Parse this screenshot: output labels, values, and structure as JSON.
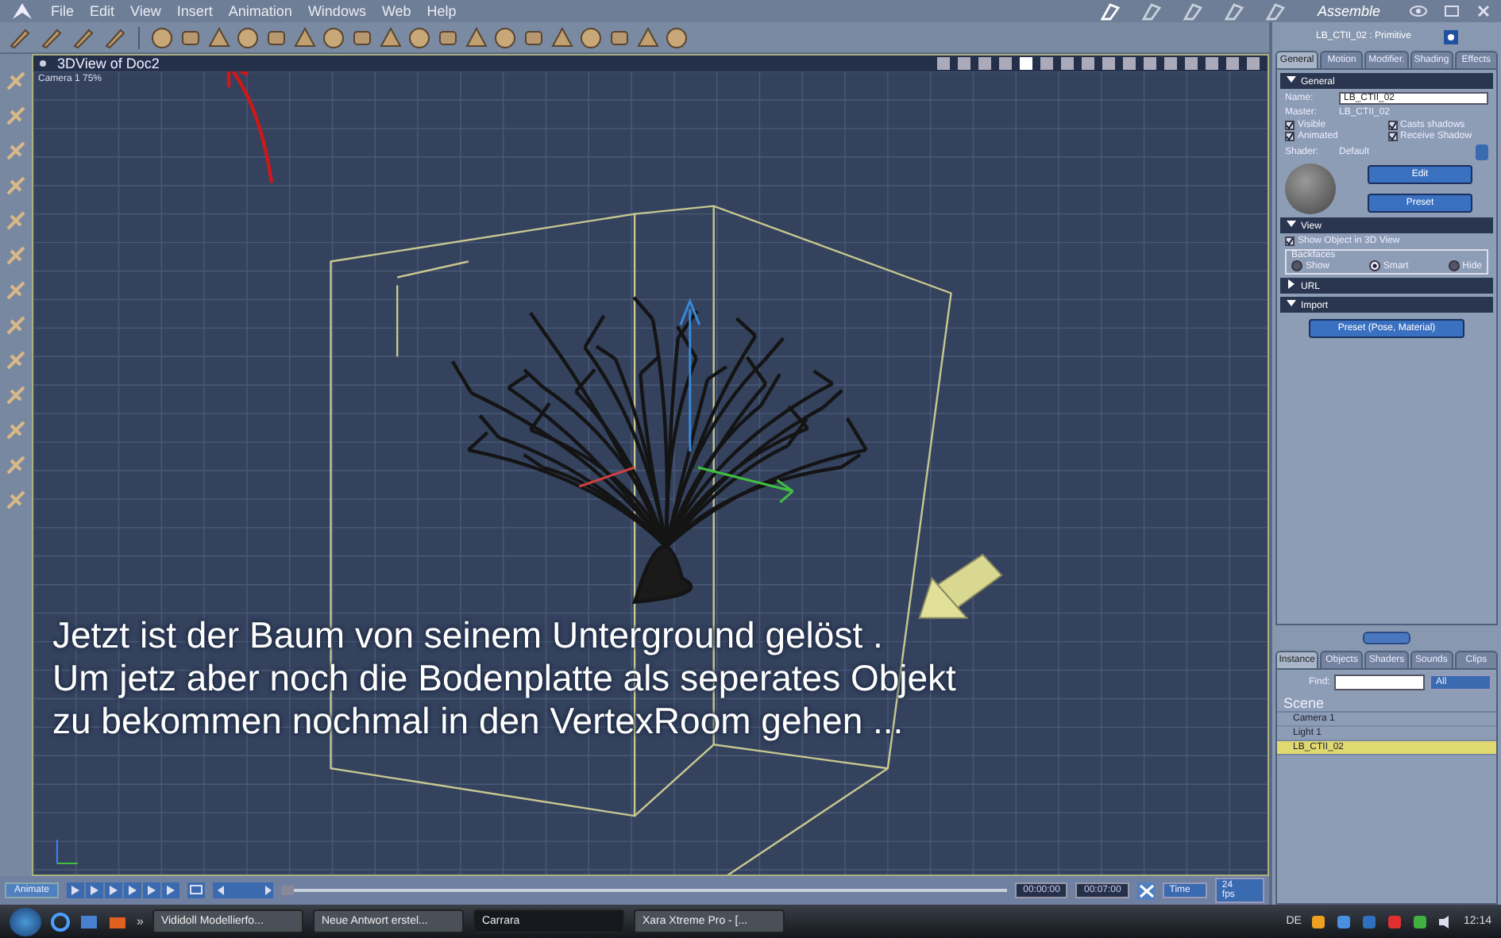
{
  "menu_bar": {
    "items": [
      "File",
      "Edit",
      "View",
      "Insert",
      "Animation",
      "Windows",
      "Web",
      "Help"
    ]
  },
  "room_label": "Assemble",
  "viewport": {
    "title": "3DView of Doc2",
    "camera_label": "Camera 1 75%",
    "caption_lines": [
      "Jetzt ist der Baum von seinem Unterground gelöst .",
      "Um jetz aber noch die Bodenplatte als seperates Objekt",
      "zu bekommen nochmal in den VertexRoom gehen ..."
    ]
  },
  "properties": {
    "header": "LB_CTII_02 : Primitive",
    "tabs": [
      {
        "label": "General",
        "selected": true
      },
      {
        "label": "Motion",
        "selected": false
      },
      {
        "label": "Modifier.",
        "selected": false
      },
      {
        "label": "Shading",
        "selected": false
      },
      {
        "label": "Effects",
        "selected": false
      }
    ],
    "general": {
      "section": "General",
      "expanded": true,
      "name_label": "Name:",
      "name_value": "LB_CTII_02",
      "master_label": "Master:",
      "master_value": "LB_CTII_02",
      "checkboxes": [
        {
          "label": "Visible",
          "checked": true
        },
        {
          "label": "Casts shadows",
          "checked": true
        },
        {
          "label": "Animated",
          "checked": true
        },
        {
          "label": "Receive Shadow",
          "checked": true
        }
      ],
      "shader_label": "Shader:",
      "shader_value": "Default",
      "buttons": [
        "Edit",
        "Preset"
      ]
    },
    "view": {
      "section": "View",
      "expanded": true,
      "show_object": {
        "label": "Show Object in 3D View",
        "checked": true
      },
      "backfaces_label": "Backfaces",
      "radios": [
        {
          "label": "Show",
          "selected": false
        },
        {
          "label": "Smart",
          "selected": true
        },
        {
          "label": "Hide",
          "selected": false
        }
      ]
    },
    "url": {
      "section": "URL",
      "expanded": false
    },
    "import": {
      "section": "Import",
      "expanded": true,
      "button": "Preset (Pose, Material)"
    }
  },
  "browser": {
    "tabs": [
      {
        "label": "Instance",
        "selected": true
      },
      {
        "label": "Objects",
        "selected": false
      },
      {
        "label": "Shaders",
        "selected": false
      },
      {
        "label": "Sounds",
        "selected": false
      },
      {
        "label": "Clips",
        "selected": false
      }
    ],
    "find_label": "Find:",
    "filter": "All",
    "tree": {
      "label": "Scene",
      "children": [
        {
          "label": "Camera 1",
          "selected": false
        },
        {
          "label": "Light 1",
          "selected": false
        },
        {
          "label": "LB_CTII_02",
          "selected": true
        }
      ]
    }
  },
  "timeline": {
    "animate_button": "Animate",
    "position": {
      "level": 0
    },
    "start_time": "00:00:00",
    "end_time": "00:07:00",
    "time_unit": "Time",
    "fps": "24 fps"
  },
  "taskbar": {
    "overflow": "»",
    "tasks": [
      {
        "label": "Vididoll Modellierfo...",
        "selected": false
      },
      {
        "label": "Neue Antwort erstel...",
        "selected": false
      },
      {
        "label": "Carrara",
        "selected": true
      },
      {
        "label": "Xara Xtreme Pro - [...",
        "selected": false
      }
    ],
    "language": "DE",
    "clock": "12:14"
  }
}
